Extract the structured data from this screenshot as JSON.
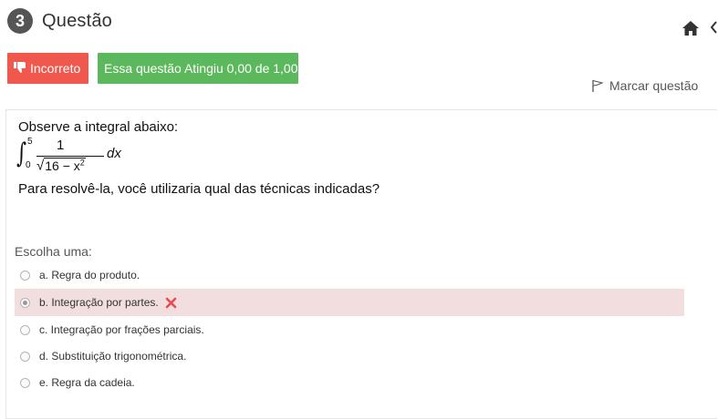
{
  "header": {
    "number": "3",
    "title": "Questão"
  },
  "badges": {
    "incorrect": "Incorreto",
    "score": "Essa questão Atingiu 0,00 de 1,00"
  },
  "flag": {
    "label": "Marcar questão"
  },
  "question": {
    "intro": "Observe a integral abaixo:",
    "integral": {
      "upper": "5",
      "lower": "0",
      "numerator": "1",
      "radicand_prefix": "16 − x",
      "exponent": "2",
      "differential": "dx"
    },
    "prompt": "Para resolvê-la, você utilizaria qual das técnicas indicadas?"
  },
  "answer": {
    "label": "Escolha uma:",
    "options": [
      {
        "text": "a. Regra do produto."
      },
      {
        "text": "b. Integração por partes."
      },
      {
        "text": "c. Integração por frações parciais."
      },
      {
        "text": "d. Substituição trigonométrica."
      },
      {
        "text": "e. Regra da cadeia."
      }
    ]
  },
  "colors": {
    "incorrect": "#f0584d",
    "score": "#5cb85c",
    "incorrect_row": "#f2dede"
  },
  "icons": [
    "home-icon",
    "chevron-left-icon",
    "thumbs-down-icon",
    "flag-icon",
    "cross-icon"
  ]
}
